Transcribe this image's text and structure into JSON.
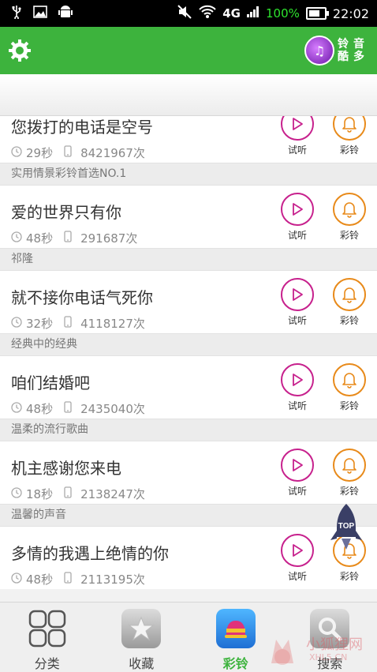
{
  "status_bar": {
    "network": "4G",
    "battery_percent": "100%",
    "time": "22:02"
  },
  "header": {
    "settings_icon": "gear-icon",
    "logo_text": [
      "铃",
      "音",
      "酷",
      "多"
    ]
  },
  "list": [
    {
      "type": "item",
      "title": "您拨打的电话是空号",
      "duration": "29秒",
      "plays": "8421967次",
      "play_label": "试听",
      "ring_label": "彩铃"
    },
    {
      "type": "section",
      "label": "实用情景彩铃首选NO.1"
    },
    {
      "type": "item",
      "title": "爱的世界只有你",
      "duration": "48秒",
      "plays": "291687次",
      "play_label": "试听",
      "ring_label": "彩铃"
    },
    {
      "type": "section",
      "label": "祁隆"
    },
    {
      "type": "item",
      "title": "就不接你电话气死你",
      "duration": "32秒",
      "plays": "4118127次",
      "play_label": "试听",
      "ring_label": "彩铃"
    },
    {
      "type": "section",
      "label": "经典中的经典"
    },
    {
      "type": "item",
      "title": "咱们结婚吧",
      "duration": "48秒",
      "plays": "2435040次",
      "play_label": "试听",
      "ring_label": "彩铃"
    },
    {
      "type": "section",
      "label": "温柔的流行歌曲"
    },
    {
      "type": "item",
      "title": "机主感谢您来电",
      "duration": "18秒",
      "plays": "2138247次",
      "play_label": "试听",
      "ring_label": "彩铃"
    },
    {
      "type": "section",
      "label": "温馨的声音"
    },
    {
      "type": "item",
      "title": "多情的我遇上绝情的你",
      "duration": "48秒",
      "plays": "2113195次",
      "play_label": "试听",
      "ring_label": "彩铃"
    }
  ],
  "top_button": {
    "label": "TOP"
  },
  "tabs": [
    {
      "label": "分类",
      "icon": "grid-icon",
      "active": false
    },
    {
      "label": "收藏",
      "icon": "star-icon",
      "active": false
    },
    {
      "label": "彩铃",
      "icon": "bell-icon",
      "active": true
    },
    {
      "label": "搜索",
      "icon": "search-icon",
      "active": false
    }
  ],
  "watermark": {
    "text": "小狐狸网",
    "sub": "XHL5.CN"
  },
  "colors": {
    "header_green": "#3db33d",
    "play_magenta": "#c7218d",
    "ring_orange": "#e88a1a"
  }
}
